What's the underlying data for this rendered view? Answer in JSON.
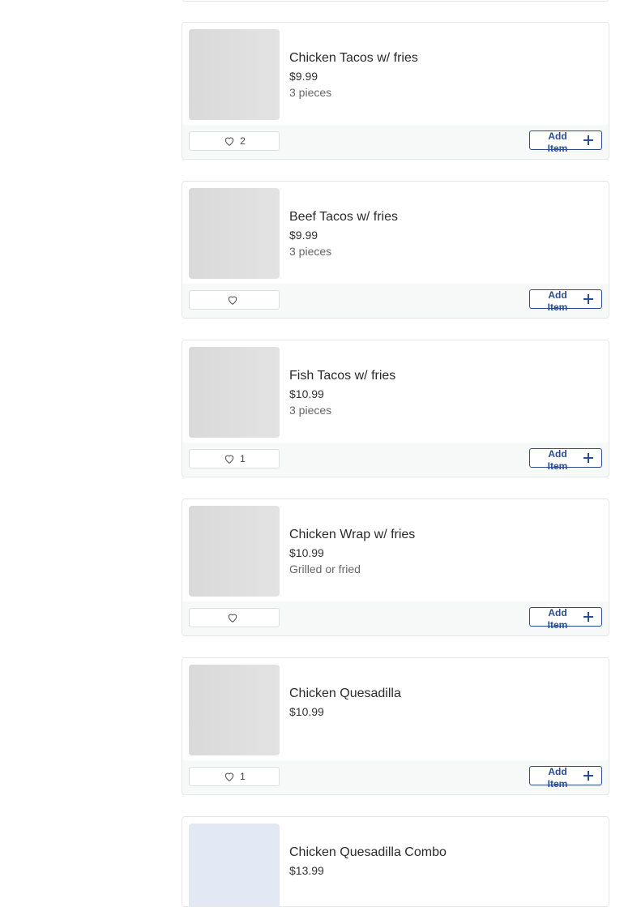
{
  "colors": {
    "accent": "#2a4d8f",
    "footer_bg": "#f7f8f8",
    "card_border": "#e4e6e8"
  },
  "items": [
    {
      "name": "Chicken Tacos w/ fries",
      "price": "$9.99",
      "description": "3 pieces",
      "likes": "2",
      "add_label": "Add Item"
    },
    {
      "name": "Beef Tacos w/ fries",
      "price": "$9.99",
      "description": "3 pieces",
      "likes": "",
      "add_label": "Add Item"
    },
    {
      "name": "Fish Tacos w/ fries",
      "price": "$10.99",
      "description": "3 pieces",
      "likes": "1",
      "add_label": "Add Item"
    },
    {
      "name": "Chicken Wrap w/ fries",
      "price": "$10.99",
      "description": "Grilled or fried",
      "likes": "",
      "add_label": "Add Item"
    },
    {
      "name": "Chicken Quesadilla",
      "price": "$10.99",
      "description": "",
      "likes": "1",
      "add_label": "Add Item"
    },
    {
      "name": "Chicken Quesadilla Combo",
      "price": "$13.99",
      "description": ""
    }
  ]
}
